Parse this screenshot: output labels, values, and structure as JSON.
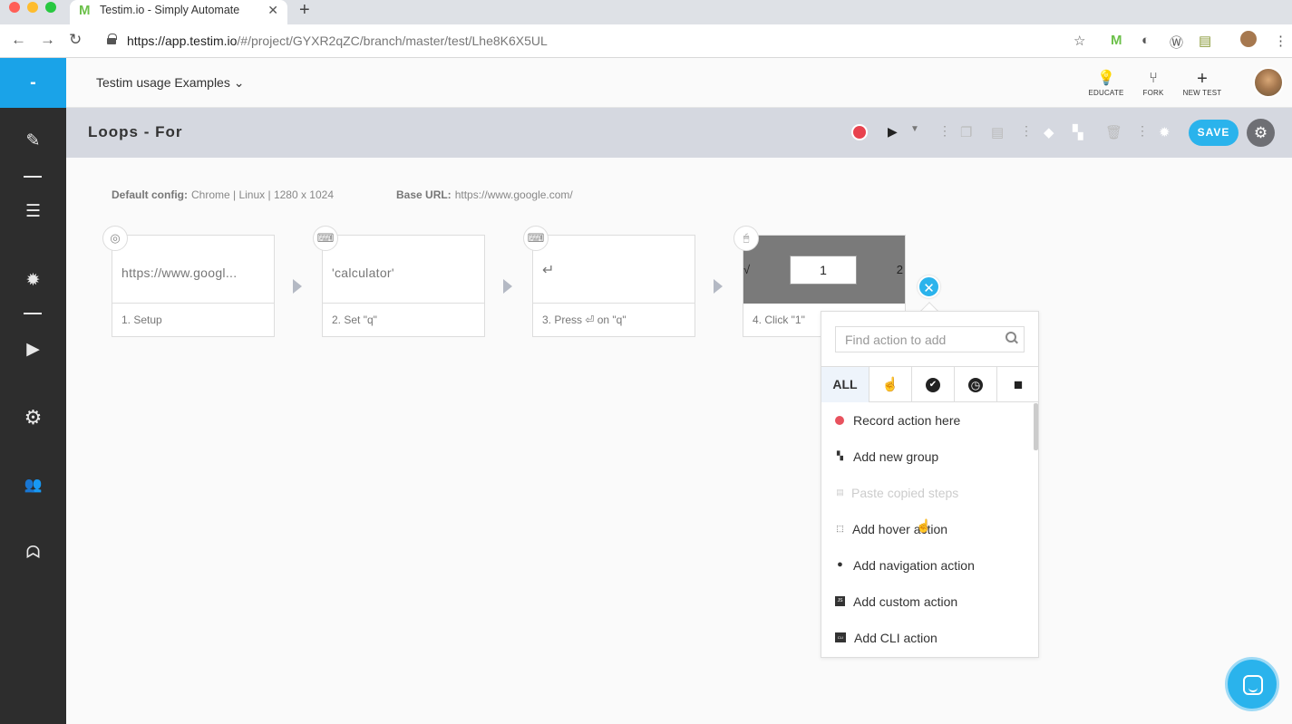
{
  "browser": {
    "tab_title": "Testim.io - Simply Automate",
    "tab_favicon": "M",
    "url_host": "https://app.testim.io",
    "url_path": "/#/project/GYXR2qZC/branch/master/test/Lhe8K6X5UL"
  },
  "sidebar": {
    "logo": "-",
    "items": [
      {
        "icon": "pencil-icon",
        "glyph": "✎"
      },
      {
        "icon": "list-icon",
        "glyph": "☰"
      },
      {
        "icon": "bug-icon",
        "glyph": "✹"
      },
      {
        "icon": "suite-icon",
        "glyph": "▶"
      },
      {
        "icon": "gear-icon",
        "glyph": "⚙"
      },
      {
        "icon": "users-icon",
        "glyph": "👥"
      },
      {
        "icon": "mask-icon",
        "glyph": "ᗣ"
      }
    ]
  },
  "header": {
    "project_name": "Testim usage Examples",
    "actions": [
      {
        "label": "EDUCATE",
        "glyph": "💡"
      },
      {
        "label": "FORK",
        "glyph": "⑂"
      },
      {
        "label": "NEW TEST",
        "glyph": "+"
      }
    ]
  },
  "test": {
    "title": "Loops - For",
    "save_label": "SAVE"
  },
  "config": {
    "default_label": "Default config:",
    "default_value": "Chrome | Linux | 1280 x 1024",
    "base_label": "Base URL:",
    "base_value": "https://www.google.com/"
  },
  "steps": [
    {
      "text": "https://www.googl...",
      "label": "1. Setup",
      "badge": "chrome-icon",
      "badge_glyph": "◎"
    },
    {
      "text": "'calculator'",
      "label": "2. Set \"q\"",
      "badge": "keyboard-icon",
      "badge_glyph": "⌨"
    },
    {
      "text": "↵",
      "label": "3. Press ⏎ on \"q\"",
      "badge": "keyboard-icon",
      "badge_glyph": "⌨"
    },
    {
      "text": "1",
      "label": "4. Click \"1\"",
      "badge": "mouse-icon",
      "badge_glyph": "🖱",
      "thumb_left": "√",
      "thumb_right": "2"
    }
  ],
  "popup": {
    "search_placeholder": "Find action to add",
    "filters": [
      {
        "label": "ALL",
        "icon": "all"
      },
      {
        "label": "",
        "icon": "hand-icon",
        "glyph": "☝"
      },
      {
        "label": "",
        "icon": "check-icon",
        "glyph": "✔"
      },
      {
        "label": "",
        "icon": "clock-icon",
        "glyph": "◷"
      },
      {
        "label": "",
        "icon": "folder-icon",
        "glyph": "■"
      }
    ],
    "actions": [
      {
        "label": "Record action here",
        "icon": "record-icon",
        "disabled": false
      },
      {
        "label": "Add new group",
        "icon": "group-icon",
        "glyph": "▚",
        "disabled": false
      },
      {
        "label": "Paste copied steps",
        "icon": "paste-icon",
        "glyph": "▤",
        "disabled": true
      },
      {
        "label": "Add hover action",
        "icon": "hover-icon",
        "glyph": "⬚",
        "disabled": false
      },
      {
        "label": "Add navigation action",
        "icon": "navigation-icon",
        "glyph": "●",
        "disabled": false
      },
      {
        "label": "Add custom action",
        "icon": "js-icon",
        "glyph": "JS",
        "disabled": false
      },
      {
        "label": "Add CLI action",
        "icon": "cli-icon",
        "glyph": "CLI",
        "disabled": false
      }
    ]
  }
}
